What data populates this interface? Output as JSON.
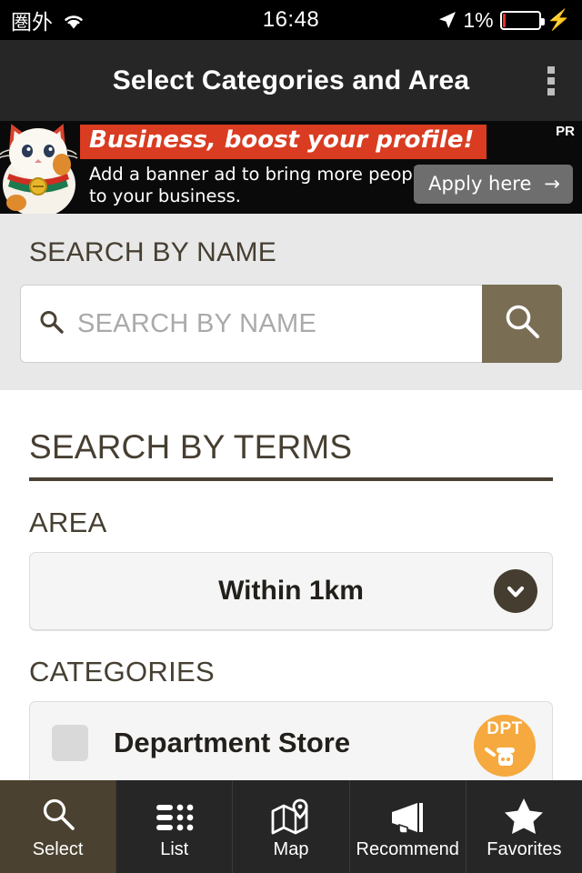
{
  "status_bar": {
    "carrier": "圏外",
    "wifi_icon": "wifi-icon",
    "time": "16:48",
    "location_icon": "location-arrow-icon",
    "battery_percent": "1%",
    "battery_icon": "battery-icon",
    "charging_icon": "lightning-bolt-icon"
  },
  "header": {
    "title": "Select Categories and Area",
    "overflow_icon": "kebab-menu-icon"
  },
  "ad": {
    "pr_label": "PR",
    "headline": "Business, boost your profile!",
    "body": "Add a banner ad to bring more people to your business.",
    "cta_label": "Apply here",
    "cta_arrow": "→",
    "image_icon": "maneki-neko-icon",
    "headline_color": "#d93c21"
  },
  "search_by_name": {
    "section_label": "SEARCH BY NAME",
    "input_value": "",
    "placeholder": "SEARCH BY NAME",
    "input_icon": "search-icon",
    "button_icon": "search-icon",
    "button_color": "#796d54"
  },
  "search_by_terms": {
    "section_title": "SEARCH BY TERMS",
    "area": {
      "label": "AREA",
      "selected": "Within 1km",
      "chevron_icon": "chevron-down-icon"
    },
    "categories": {
      "label": "CATEGORIES",
      "items": [
        {
          "name": "Department Store",
          "checked": false,
          "badge_text": "DPT",
          "badge_color": "#f5a93e",
          "badge_icon": "department-store-mascot-icon"
        }
      ]
    }
  },
  "tabbar": {
    "items": [
      {
        "label": "Select",
        "icon": "search-icon",
        "active": true
      },
      {
        "label": "List",
        "icon": "list-icon",
        "active": false
      },
      {
        "label": "Map",
        "icon": "map-pin-icon",
        "active": false
      },
      {
        "label": "Recommend",
        "icon": "megaphone-icon",
        "active": false
      },
      {
        "label": "Favorites",
        "icon": "star-icon",
        "active": false
      }
    ],
    "active_color": "#4a4130"
  }
}
